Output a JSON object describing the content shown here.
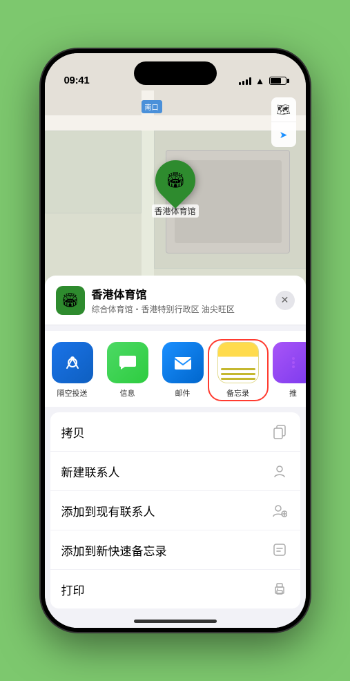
{
  "status_bar": {
    "time": "09:41",
    "location_arrow": "▶"
  },
  "map": {
    "label_nankou": "南口",
    "map_type_icon": "🗺",
    "location_icon": "➤",
    "pin_label": "香港体育馆",
    "stadium_emoji": "🏟"
  },
  "venue": {
    "name": "香港体育馆",
    "subtitle": "综合体育馆・香港特别行政区 油尖旺区",
    "icon_emoji": "🏟"
  },
  "share_actions": [
    {
      "id": "airdrop",
      "label": "隔空投送",
      "type": "airdrop"
    },
    {
      "id": "messages",
      "label": "信息",
      "type": "messages"
    },
    {
      "id": "mail",
      "label": "邮件",
      "type": "mail"
    },
    {
      "id": "notes",
      "label": "备忘录",
      "type": "notes"
    },
    {
      "id": "more",
      "label": "推",
      "type": "more"
    }
  ],
  "actions": [
    {
      "id": "copy",
      "label": "拷贝",
      "icon": "copy"
    },
    {
      "id": "new-contact",
      "label": "新建联系人",
      "icon": "person"
    },
    {
      "id": "add-existing",
      "label": "添加到现有联系人",
      "icon": "person-add"
    },
    {
      "id": "add-notes",
      "label": "添加到新快速备忘录",
      "icon": "note"
    },
    {
      "id": "print",
      "label": "打印",
      "icon": "printer"
    }
  ],
  "close_button_label": "✕"
}
